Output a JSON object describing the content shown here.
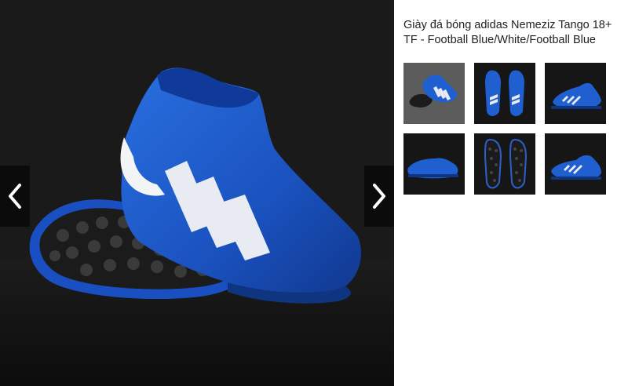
{
  "product": {
    "title": "Giày đá bóng adidas Nemeziz Tango 18+ TF - Football Blue/White/Football Blue"
  },
  "gallery": {
    "selected_index": 0,
    "thumbnails": [
      {
        "view": "side-pair"
      },
      {
        "view": "top-pair"
      },
      {
        "view": "side-single"
      },
      {
        "view": "inner-side"
      },
      {
        "view": "soles"
      },
      {
        "view": "side-single-right"
      }
    ],
    "prev_icon": "chevron-left-icon",
    "next_icon": "chevron-right-icon"
  },
  "colors": {
    "shoe_blue": "#1f5fd0",
    "shoe_dark_blue": "#123a8e",
    "stripe_white": "#e8ecf2",
    "active_outline": "#e0705a"
  }
}
